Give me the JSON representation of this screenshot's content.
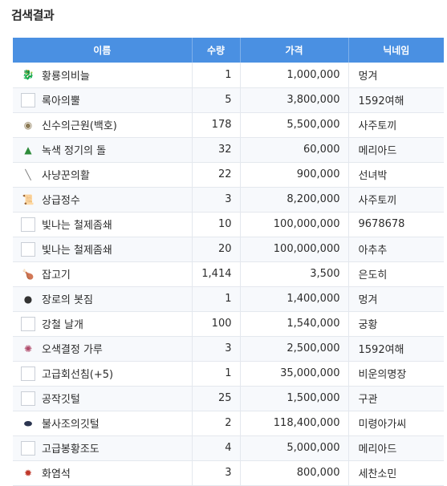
{
  "page": {
    "title": "검색결과"
  },
  "table": {
    "headers": [
      "이름",
      "수량",
      "가격",
      "닉네임"
    ],
    "rows": [
      {
        "icon": "scale-icon",
        "glyph": "🐉",
        "color": "#c0673a",
        "name": "황룡의비늘",
        "qty": "1",
        "price": "1,000,000",
        "nick": "멍겨"
      },
      {
        "icon": "empty-icon",
        "glyph": "",
        "color": "",
        "name": "록아의뿔",
        "qty": "5",
        "price": "3,800,000",
        "nick": "1592여해"
      },
      {
        "icon": "coin-icon",
        "glyph": "◉",
        "color": "#8c7a55",
        "name": "신수의근원(백호)",
        "qty": "178",
        "price": "5,500,000",
        "nick": "사주토끼"
      },
      {
        "icon": "green-stone-icon",
        "glyph": "▲",
        "color": "#2e8b3a",
        "name": "녹색 정기의 돌",
        "qty": "32",
        "price": "60,000",
        "nick": "메리아드"
      },
      {
        "icon": "bow-icon",
        "glyph": "╲",
        "color": "#777777",
        "name": "사냥꾼의활",
        "qty": "22",
        "price": "900,000",
        "nick": "선녀박"
      },
      {
        "icon": "scroll-icon",
        "glyph": "📜",
        "color": "#b08a4a",
        "name": "상급정수",
        "qty": "3",
        "price": "8,200,000",
        "nick": "사주토끼"
      },
      {
        "icon": "empty-icon",
        "glyph": "",
        "color": "",
        "name": "빛나는 철제좀쇄",
        "qty": "10",
        "price": "100,000,000",
        "nick": "9678678"
      },
      {
        "icon": "empty-icon",
        "glyph": "",
        "color": "",
        "name": "빛나는 철제좀쇄",
        "qty": "20",
        "price": "100,000,000",
        "nick": "아추추"
      },
      {
        "icon": "meat-icon",
        "glyph": "🍗",
        "color": "#c1442a",
        "name": "잡고기",
        "qty": "1,414",
        "price": "3,500",
        "nick": "은도히"
      },
      {
        "icon": "pouch-icon",
        "glyph": "●",
        "color": "#333333",
        "name": "장로의 봇짐",
        "qty": "1",
        "price": "1,400,000",
        "nick": "멍겨"
      },
      {
        "icon": "empty-icon",
        "glyph": "",
        "color": "",
        "name": "강철 날개",
        "qty": "100",
        "price": "1,540,000",
        "nick": "궁황"
      },
      {
        "icon": "powder-icon",
        "glyph": "✺",
        "color": "#b04a6a",
        "name": "오색결정 가루",
        "qty": "3",
        "price": "2,500,000",
        "nick": "1592여해"
      },
      {
        "icon": "empty-icon",
        "glyph": "",
        "color": "",
        "name": "고급회선침(+5)",
        "qty": "1",
        "price": "35,000,000",
        "nick": "비운의명장"
      },
      {
        "icon": "empty-icon",
        "glyph": "",
        "color": "",
        "name": "공작깃털",
        "qty": "25",
        "price": "1,500,000",
        "nick": "구관"
      },
      {
        "icon": "dark-feather-icon",
        "glyph": "⬬",
        "color": "#2b3550",
        "name": "불사조의깃털",
        "qty": "2",
        "price": "118,400,000",
        "nick": "미령아가씨"
      },
      {
        "icon": "empty-icon",
        "glyph": "",
        "color": "",
        "name": "고급봉황조도",
        "qty": "4",
        "price": "5,000,000",
        "nick": "메리아드"
      },
      {
        "icon": "fire-stone-icon",
        "glyph": "✹",
        "color": "#c0392b",
        "name": "화염석",
        "qty": "3",
        "price": "800,000",
        "nick": "세찬소민"
      }
    ]
  }
}
